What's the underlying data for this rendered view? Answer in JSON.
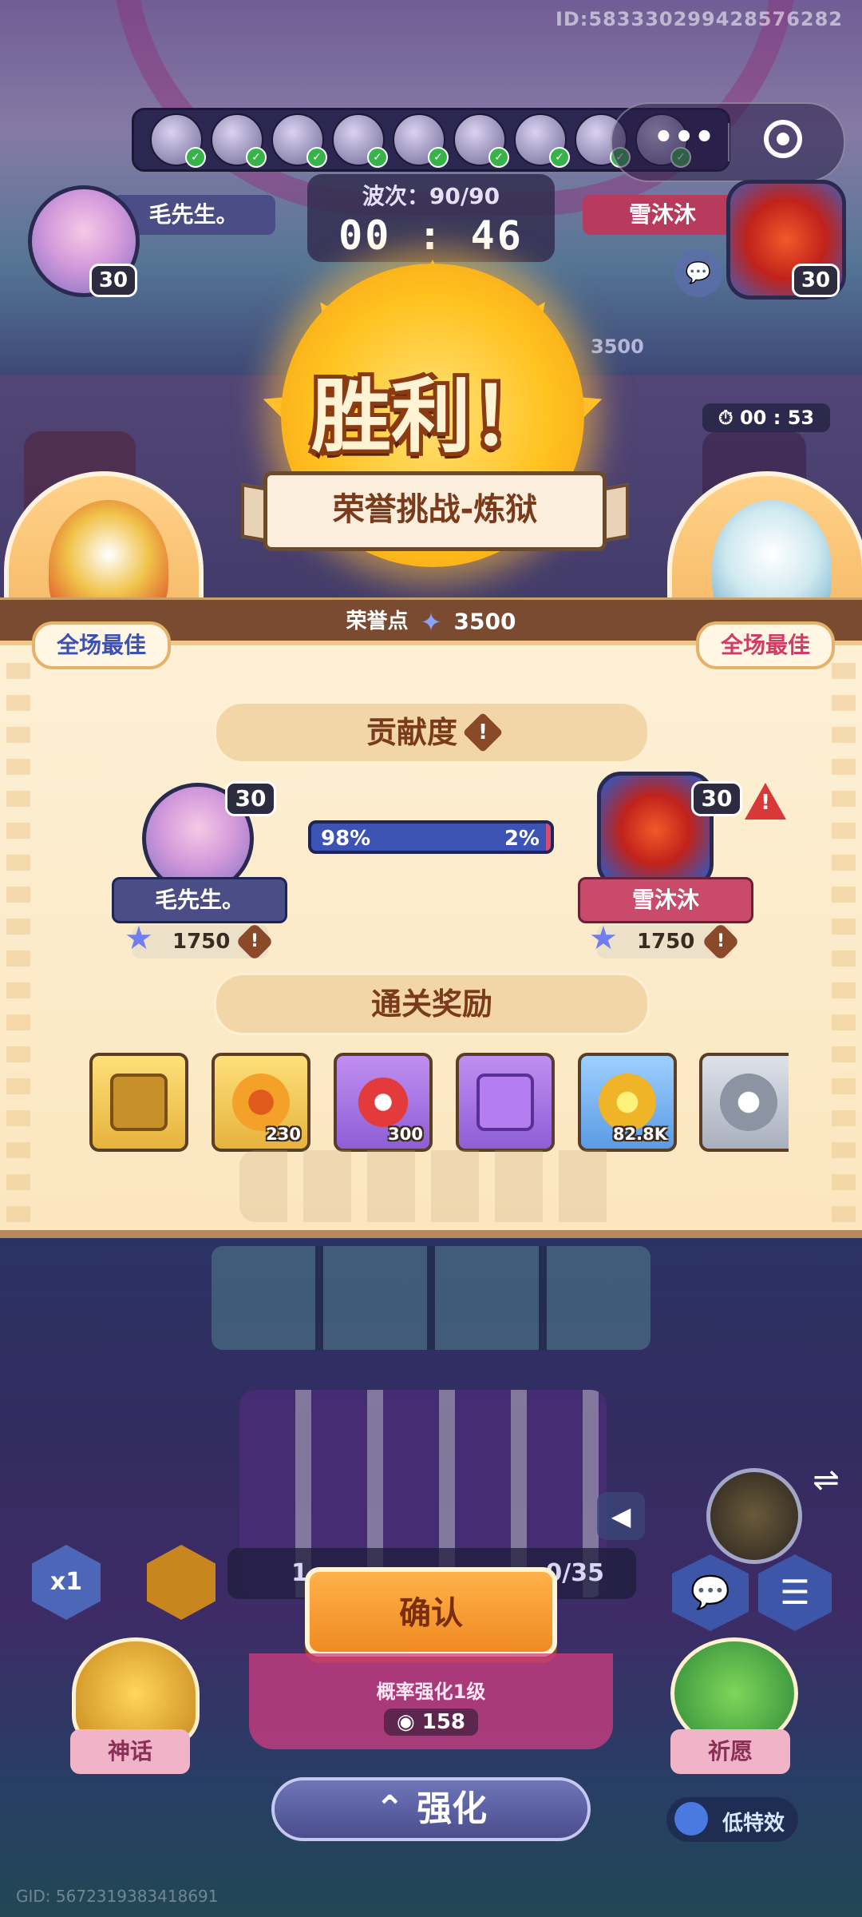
{
  "header": {
    "user_id": "ID:5833302994285762​82",
    "gid": "GID: 5672319383418691"
  },
  "top_hud": {
    "left_player": {
      "name": "毛先生。",
      "level": "30"
    },
    "right_player": {
      "name": "雪沐沐",
      "level": "30"
    },
    "wave": "波次：90/90",
    "timer": "00 : 46",
    "side_timer": "00 : 53",
    "side_score": "3500"
  },
  "victory": {
    "title": "胜利！",
    "subtitle": "荣誉挑战-炼狱",
    "honor_label": "荣誉点",
    "honor_value": "3500",
    "mvp_left": "全场最佳",
    "mvp_right": "全场最佳"
  },
  "contribution": {
    "title": "贡献度",
    "left_pct_label": "98%",
    "right_pct_label": "2%",
    "left_fraction": 0.98,
    "left": {
      "name": "毛先生。",
      "level": "30",
      "score": "1750"
    },
    "right": {
      "name": "雪沐沐",
      "level": "30",
      "score": "1750"
    }
  },
  "rewards": {
    "title": "通关奖励",
    "items": [
      {
        "icon": "gold-chest-icon",
        "qty": "",
        "style": "gold"
      },
      {
        "icon": "gold-key-icon",
        "qty": "230",
        "style": "gold"
      },
      {
        "icon": "red-potion-icon",
        "qty": "300",
        "style": "purple"
      },
      {
        "icon": "purple-chest-icon",
        "qty": "",
        "style": "purple"
      },
      {
        "icon": "gold-coin-icon",
        "qty": "82.8K",
        "style": "blue"
      },
      {
        "icon": "silver-token-icon",
        "qty": "",
        "style": "grey"
      }
    ]
  },
  "bottom": {
    "speed_label": "x1",
    "stats_left": "1",
    "stats_right": "0/35",
    "confirm_label": "确认",
    "strengthen_desc": "概率强化1级",
    "strengthen_cost": "158",
    "upgrade_label": "强化",
    "myth_label": "神话",
    "wish_label": "祈愿",
    "low_fx_label": "低特效"
  },
  "colors": {
    "blue_player": "#3c53b4",
    "red_player": "#d84a70",
    "panel": "#fbe8c4",
    "confirm": "#f08a22"
  }
}
